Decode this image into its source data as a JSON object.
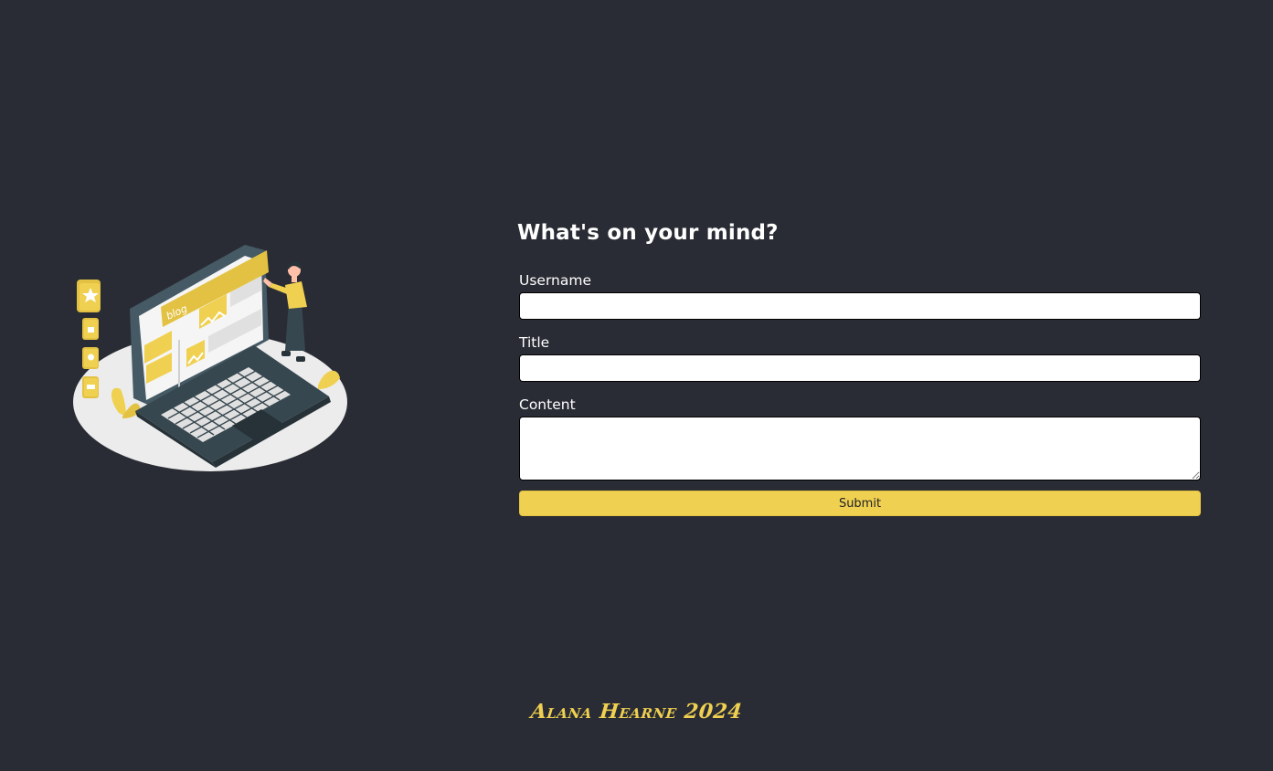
{
  "form": {
    "title": "What's on your mind?",
    "username_label": "Username",
    "username_value": "",
    "title_label": "Title",
    "title_value": "",
    "content_label": "Content",
    "content_value": "",
    "submit_label": "Submit"
  },
  "illustration": {
    "screen_banner_text": "blog"
  },
  "footer": {
    "text": "Alana Hearne 2024"
  },
  "colors": {
    "background": "#292c34",
    "accent": "#f0d050",
    "text": "#ffffff"
  }
}
